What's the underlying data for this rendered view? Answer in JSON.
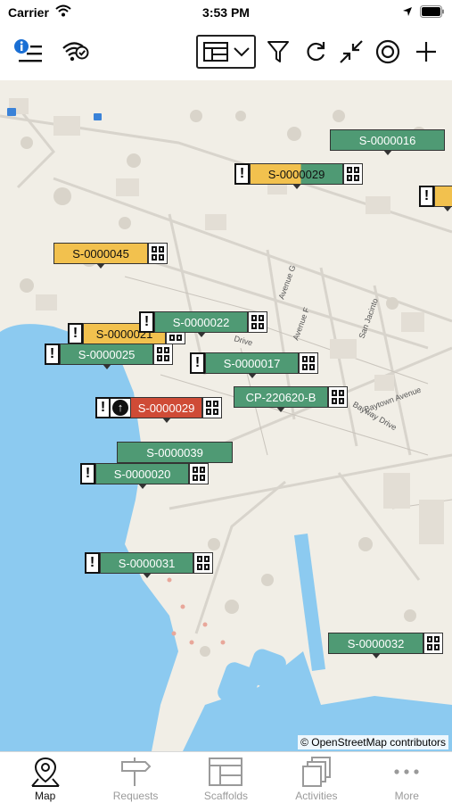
{
  "status": {
    "carrier": "Carrier",
    "time": "3:53 PM"
  },
  "toolbar": {
    "icons": [
      "info-list-icon",
      "wifi-check-icon",
      "layer-select",
      "filter-icon",
      "refresh-icon",
      "collapse-icon",
      "target-icon",
      "add-icon"
    ]
  },
  "map": {
    "attribution": "© OpenStreetMap contributors",
    "street_labels": [
      "Avenue G",
      "Avenue F",
      "San Jacinto",
      "Baytown Avenue",
      "Bayway Drive",
      "Drive"
    ],
    "markers": [
      {
        "id": "S-0000016",
        "color": "green"
      },
      {
        "id": "S-0000029",
        "color": "split",
        "warning": true,
        "qr": true
      },
      {
        "id": "S-0000045",
        "color": "yellow",
        "qr": true
      },
      {
        "id": "S-0000022",
        "color": "green",
        "warning": true,
        "qr": true
      },
      {
        "id": "S-0000021",
        "color": "yellow",
        "warning": true,
        "qr": true
      },
      {
        "id": "S-0000025",
        "color": "green",
        "warning": true,
        "qr": true
      },
      {
        "id": "S-0000017",
        "color": "green",
        "warning": true,
        "qr": true
      },
      {
        "id": "CP-220620-B",
        "color": "green",
        "qr": true
      },
      {
        "id": "S-0000029",
        "color": "red",
        "warning": true,
        "lift": true,
        "qr": true
      },
      {
        "id": "S-0000039",
        "color": "green"
      },
      {
        "id": "S-0000020",
        "color": "green",
        "warning": true,
        "qr": true
      },
      {
        "id": "S-0000031",
        "color": "green",
        "warning": true,
        "qr": true
      },
      {
        "id": "S-0000032",
        "color": "green",
        "qr": true
      }
    ]
  },
  "tabs": [
    {
      "label": "Map",
      "icon": "map-pin-icon",
      "active": true
    },
    {
      "label": "Requests",
      "icon": "signpost-icon",
      "active": false
    },
    {
      "label": "Scaffolds",
      "icon": "scaffold-grid-icon",
      "active": false
    },
    {
      "label": "Activities",
      "icon": "stacked-pages-icon",
      "active": false
    },
    {
      "label": "More",
      "icon": "more-dots-icon",
      "active": false
    }
  ]
}
